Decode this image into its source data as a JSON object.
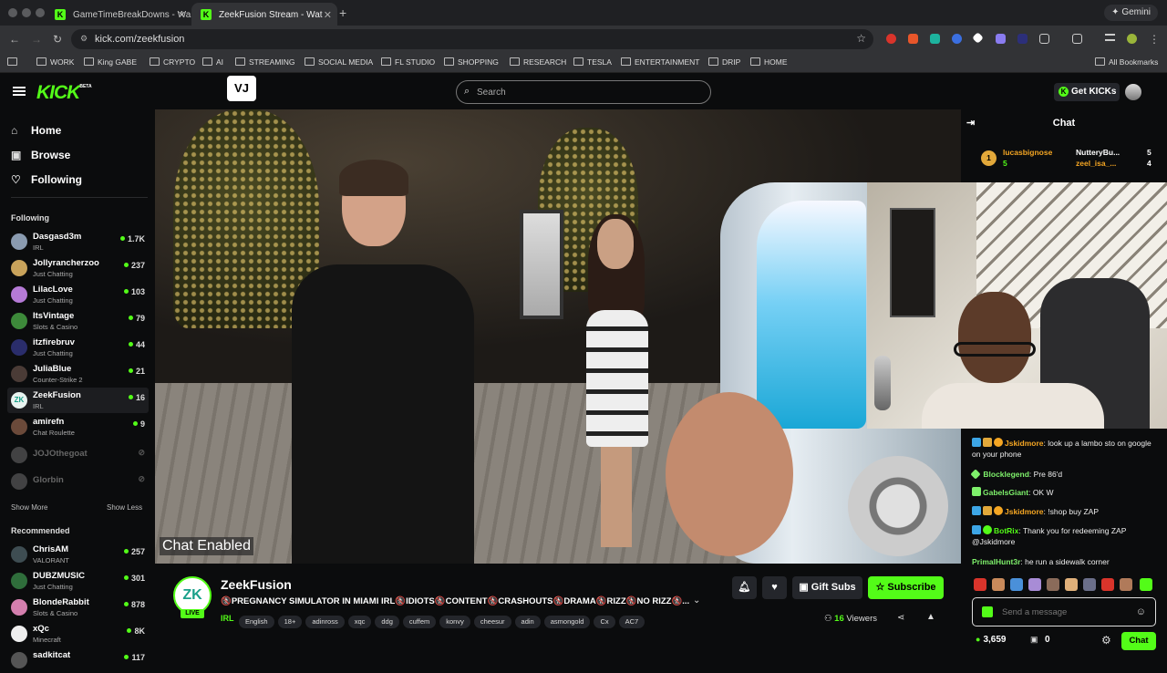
{
  "browser": {
    "tabs": [
      {
        "title": "GameTimeBreakDowns - Wa",
        "active": false
      },
      {
        "title": "ZeekFusion Stream - Wat",
        "active": true
      }
    ],
    "gemini_label": "Gemini",
    "url": "kick.com/zeekfusion",
    "bookmarks": [
      "WORK",
      "King GABE",
      "CRYPTO",
      "AI",
      "STREAMING",
      "SOCIAL MEDIA",
      "FL STUDIO",
      "SHOPPING",
      "RESEARCH",
      "TESLA",
      "ENTERTAINMENT",
      "DRIP",
      "HOME"
    ],
    "all_bookmarks": "All Bookmarks"
  },
  "kick": {
    "logo": "KICK",
    "beta": "BETA",
    "vj_label": "VJ",
    "search_placeholder": "Search",
    "get_kicks": "Get KICKs",
    "brand_color": "#53fc18"
  },
  "sidebar": {
    "nav": [
      {
        "label": "Home",
        "icon": "home-icon"
      },
      {
        "label": "Browse",
        "icon": "browse-icon"
      },
      {
        "label": "Following",
        "icon": "heart-icon"
      }
    ],
    "following_header": "Following",
    "following": [
      {
        "name": "Dasgasd3m",
        "category": "IRL",
        "viewers": "1.7K"
      },
      {
        "name": "Jollyrancherzoo",
        "category": "Just Chatting",
        "viewers": "237"
      },
      {
        "name": "LilacLove",
        "category": "Just Chatting",
        "viewers": "103"
      },
      {
        "name": "ItsVintage",
        "category": "Slots & Casino",
        "viewers": "79"
      },
      {
        "name": "itzfirebruv",
        "category": "Just Chatting",
        "viewers": "44"
      },
      {
        "name": "JuliaBlue",
        "category": "Counter-Strike 2",
        "viewers": "21"
      },
      {
        "name": "ZeekFusion",
        "category": "IRL",
        "viewers": "16"
      },
      {
        "name": "amirefn",
        "category": "Chat Roulette",
        "viewers": "9"
      },
      {
        "name": "JOJOthegoat",
        "category": "",
        "viewers": ""
      },
      {
        "name": "Glorbin",
        "category": "",
        "viewers": ""
      }
    ],
    "show_more": "Show More",
    "show_less": "Show Less",
    "recommended_header": "Recommended",
    "recommended": [
      {
        "name": "ChrisAM",
        "category": "VALORANT",
        "viewers": "257"
      },
      {
        "name": "DUBZMUSIC",
        "category": "Just Chatting",
        "viewers": "301"
      },
      {
        "name": "BlondeRabbit",
        "category": "Slots & Casino",
        "viewers": "878"
      },
      {
        "name": "xQc",
        "category": "Minecraft",
        "viewers": "8K"
      },
      {
        "name": "sadkitcat",
        "category": "",
        "viewers": "117"
      }
    ]
  },
  "player": {
    "chat_enabled": "Chat Enabled"
  },
  "stream": {
    "channel": "ZeekFusion",
    "live": "LIVE",
    "avatar_text": "ZK",
    "title": "🚷PREGNANCY SIMULATOR IN MIAMI IRL🚷IDIOTS🚷CONTENT🚷CRASHOUTS🚷DRAMA🚷RIZZ🚷NO RIZZ🚷...",
    "category": "IRL",
    "tags": [
      "English",
      "18+",
      "adinross",
      "xqc",
      "ddg",
      "cuffem",
      "konvy",
      "cheesur",
      "adin",
      "asmongold",
      "Cx",
      "AC7"
    ],
    "gift_subs": "Gift Subs",
    "subscribe": "Subscribe",
    "viewer_count": "16",
    "viewers_label": "Viewers"
  },
  "chat": {
    "title": "Chat",
    "pinned": [
      {
        "user": "lucasbignose",
        "count": "5",
        "rank": "1"
      },
      {
        "user": "NutteryBu...",
        "count": "5"
      },
      {
        "user": "zeel_isa_...",
        "count": "4"
      }
    ],
    "messages": [
      {
        "user": "Jskidmore",
        "text": "look up a lambo sto on google on your phone",
        "color": "#f5a623"
      },
      {
        "user": "Blocklegend",
        "text": "Pre 86'd",
        "color": "#7ef06b"
      },
      {
        "user": "GabelsGiant",
        "text": "OK W",
        "color": "#7ef06b"
      },
      {
        "user": "Jskidmore",
        "text": "!shop buy ZAP",
        "color": "#f5a623"
      },
      {
        "user": "BotRix",
        "text": "Thank you for redeeming ZAP @Jskidmore",
        "color": "#53fc18"
      },
      {
        "user": "PrimalHunt3r",
        "text": "he run a sidewalk corner",
        "color": "#7ef06b"
      }
    ],
    "input_placeholder": "Send a message",
    "kicks_balance": "3,659",
    "points": "0",
    "send_button": "Chat"
  }
}
